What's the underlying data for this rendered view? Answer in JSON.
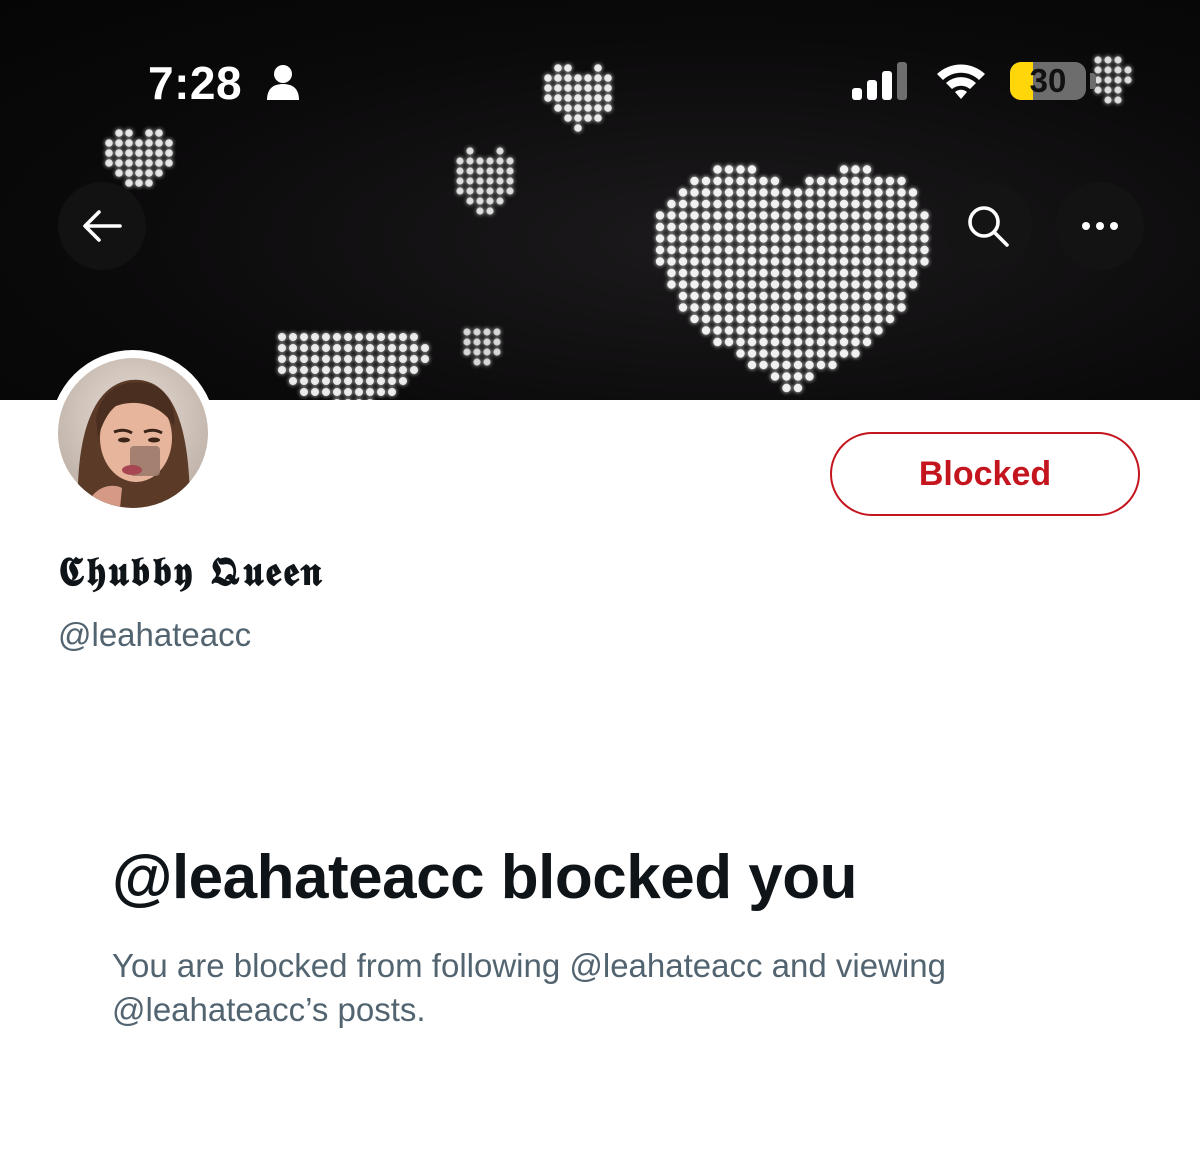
{
  "status_bar": {
    "time": "7:28",
    "battery_percent": "30",
    "battery_level": 0.3,
    "icons": [
      "person-icon",
      "signal-icon",
      "wifi-icon",
      "battery-icon"
    ]
  },
  "banner": {
    "icons": {
      "back": "arrow-left-icon",
      "search": "search-icon",
      "more": "more-horizontal-icon"
    },
    "image": "pixel-hearts-banner"
  },
  "profile": {
    "display_name": "𝕮𝖍𝖚𝖇𝖇𝖞 𝕼𝖚𝖊𝖊𝖓",
    "handle": "@leahateacc",
    "avatar": "profile-photo"
  },
  "actions": {
    "blocked_label": "Blocked"
  },
  "blocked_notice": {
    "title": "@leahateacc blocked you",
    "description_line1": "You are blocked from following @leahateacc and viewing",
    "description_line2": "@leahateacc’s posts."
  },
  "colors": {
    "blocked_red": "#c4151f",
    "text_primary": "#0f1419",
    "text_secondary": "#536471",
    "battery_yellow": "#ffd60a"
  }
}
